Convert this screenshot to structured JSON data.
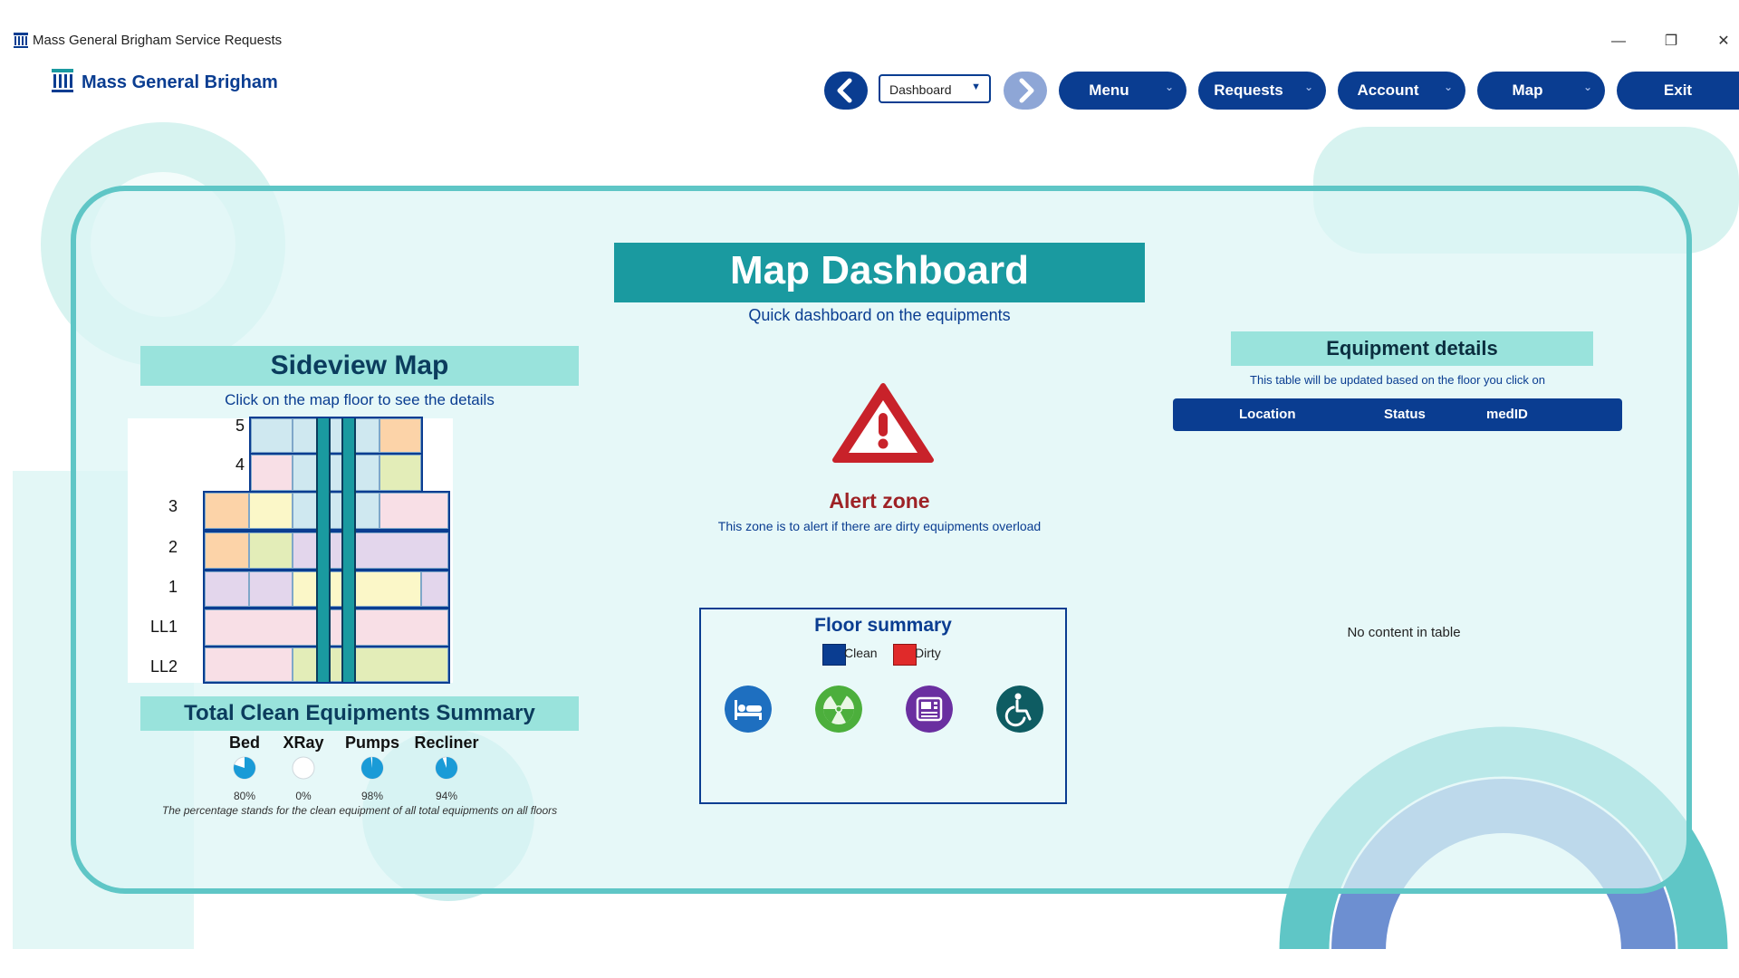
{
  "window": {
    "title": "Mass General Brigham Service Requests",
    "controls": [
      "minimize",
      "restore",
      "close"
    ]
  },
  "logo": {
    "text": "Mass General Brigham",
    "icon": "hospital-columns-icon"
  },
  "nav": {
    "back_icon": "chevron-left-icon",
    "forward_icon": "chevron-right-icon",
    "page_select": {
      "selected": "Dashboard"
    },
    "buttons": [
      {
        "label": "Menu",
        "has_dropdown": true
      },
      {
        "label": "Requests",
        "has_dropdown": true
      },
      {
        "label": "Account",
        "has_dropdown": true
      },
      {
        "label": "Map",
        "has_dropdown": true
      },
      {
        "label": "Exit",
        "has_dropdown": false
      }
    ],
    "colors": {
      "primary": "#0a3d91",
      "disabled": "#8ea6d6"
    }
  },
  "dashboard": {
    "title": "Map Dashboard",
    "subtitle": "Quick dashboard on the equipments",
    "accent": "#1a9aa0"
  },
  "sideview": {
    "title": "Sideview Map",
    "caption": "Click on the map floor to see the details",
    "floors": [
      "5",
      "4",
      "3",
      "2",
      "1",
      "LL1",
      "LL2"
    ]
  },
  "summary": {
    "title": "Total Clean Equipments Summary",
    "items": [
      {
        "name": "Bed",
        "percent": 80,
        "label": "80%"
      },
      {
        "name": "XRay",
        "percent": 0,
        "label": "0%"
      },
      {
        "name": "Pumps",
        "percent": 98,
        "label": "98%"
      },
      {
        "name": "Recliner",
        "percent": 94,
        "label": "94%"
      }
    ],
    "note": "The percentage stands for the clean equipment of all total equipments on all floors",
    "pie_color": "#1a9bd7"
  },
  "alert": {
    "title": "Alert zone",
    "text": "This zone is to alert if there are dirty equipments overload",
    "icon": "warning-triangle-icon",
    "color": "#c8222a"
  },
  "floor_summary": {
    "title": "Floor summary",
    "legend": [
      {
        "label": "Clean",
        "color": "#0a3d91"
      },
      {
        "label": "Dirty",
        "color": "#e02a2a"
      }
    ],
    "icons": [
      {
        "name": "bed-icon",
        "color": "#1e6fc0"
      },
      {
        "name": "xray-radiation-icon",
        "color": "#4caf3c"
      },
      {
        "name": "infusion-pump-icon",
        "color": "#6a2fa0"
      },
      {
        "name": "wheelchair-icon",
        "color": "#0e5c62"
      }
    ]
  },
  "equipment": {
    "title": "Equipment details",
    "caption": "This table will be updated based on the floor you click on",
    "columns": [
      "Location",
      "Status",
      "medID"
    ],
    "empty_text": "No content in table"
  }
}
